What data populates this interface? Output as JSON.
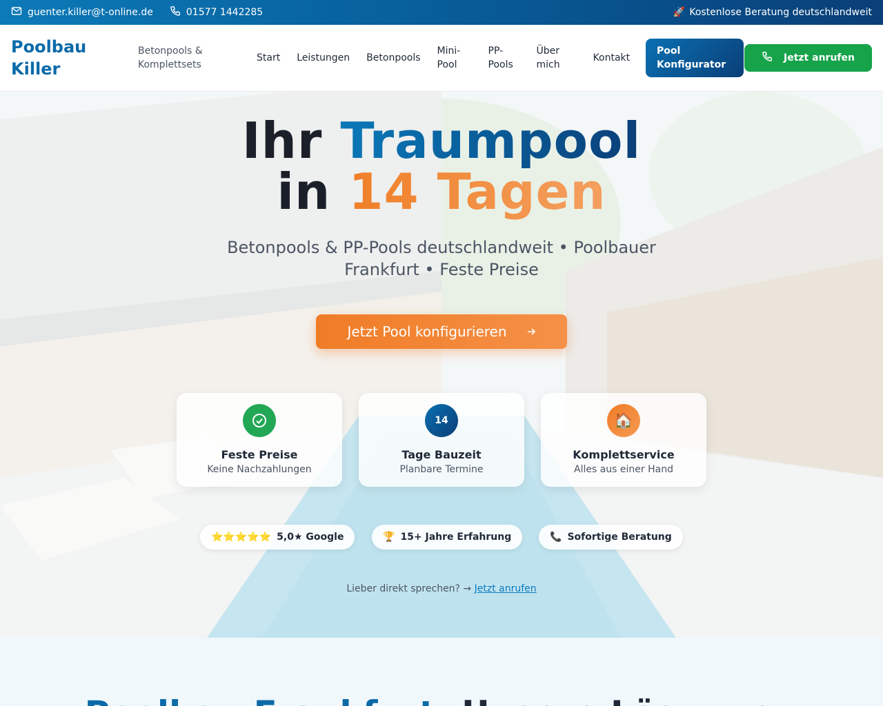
{
  "topbar": {
    "email": "guenter.killer@t-online.de",
    "phone": "01577 1442285",
    "right_icon": "🚀",
    "right_text": "Kostenlose Beratung deutschlandweit"
  },
  "nav": {
    "logo": "Poolbau Killer",
    "tagline": "Betonpools & Komplettsets",
    "items": [
      "Start",
      "Leistungen",
      "Betonpools",
      "Mini-Pool",
      "PP-Pools",
      "Über mich",
      "Kontakt"
    ],
    "konfigurator": "Pool Konfigurator",
    "call": "Jetzt anrufen"
  },
  "hero": {
    "title_1": "Ihr",
    "title_2": "Traumpool",
    "title_3": "in",
    "title_4": "14 Tagen",
    "subtitle": "Betonpools & PP-Pools deutschlandweit • Poolbauer Frankfurt • Feste Preise",
    "cta": "Jetzt Pool konfigurieren",
    "features": [
      {
        "title": "Feste Preise",
        "sub": "Keine Nachzahlungen",
        "icon": "check-circle-icon",
        "color": "#22a755"
      },
      {
        "badge": "14",
        "title": "Tage Bauzeit",
        "sub": "Planbare Termine",
        "color": "#0a4f8c"
      },
      {
        "emoji": "🏠",
        "title": "Komplettservice",
        "sub": "Alles aus einer Hand",
        "color": "#f07c26"
      }
    ],
    "pills": [
      {
        "icon": "⭐⭐⭐⭐⭐",
        "text": "5,0★ Google"
      },
      {
        "icon": "🏆",
        "text": "15+ Jahre Erfahrung"
      },
      {
        "icon": "📞",
        "text": "Sofortige Beratung"
      }
    ],
    "direct_text": "Lieber direkt sprechen? →",
    "direct_link": "Jetzt anrufen"
  },
  "section": {
    "title_blue": "Poolbau Frankfurt:",
    "title_rest": "Unsere Lösungen"
  }
}
